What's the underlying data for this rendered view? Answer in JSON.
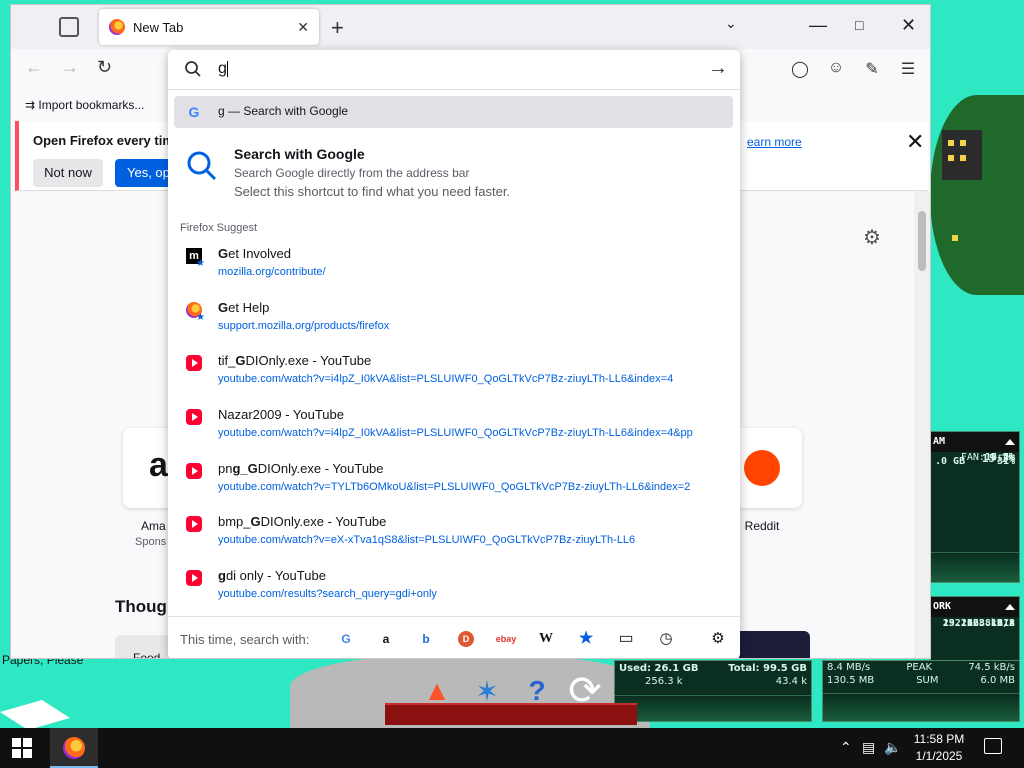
{
  "browser": {
    "tab_title": "New Tab",
    "bookmarks_item": "Import bookmarks...",
    "notice": {
      "text": "Open Firefox every time",
      "not_now": "Not now",
      "yes": "Yes, open",
      "learn": "earn more"
    },
    "thought_heading": "Though",
    "shortcuts": [
      {
        "label": "Ama",
        "sub": "Spons"
      },
      {
        "label": "Reddit"
      }
    ],
    "food_label": "Food"
  },
  "urlbar": {
    "value": "g",
    "first_result": "g — Search with Google",
    "tip": {
      "heading": "Search with Google",
      "line1": "Search Google directly from the address bar",
      "line2": "Select this shortcut to find what you need faster."
    },
    "group_label": "Firefox Suggest",
    "results": [
      {
        "bold": "G",
        "rest": "et Involved",
        "url": "mozilla.org/contribute/",
        "icon": "mozilla-icon"
      },
      {
        "bold": "G",
        "rest": "et Help",
        "url": "support.mozilla.org/products/firefox",
        "icon": "firefox-icon"
      },
      {
        "pre": "tif_",
        "bold": "G",
        "rest": "DIOnly.exe - YouTube",
        "url": "youtube.com/watch?v=i4lpZ_I0kVA&list=PLSLUIWF0_QoGLTkVcP7Bz-ziuyLTh-LL6&index=4",
        "icon": "youtube-icon"
      },
      {
        "pre": "",
        "bold": "",
        "rest": "Nazar2009 - YouTube",
        "url": "youtube.com/watch?v=i4lpZ_I0kVA&list=PLSLUIWF0_QoGLTkVcP7Bz-ziuyLTh-LL6&index=4&pp",
        "icon": "youtube-icon"
      },
      {
        "pre": "pn",
        "bold": "g_G",
        "rest": "DIOnly.exe - YouTube",
        "url": "youtube.com/watch?v=TYLTb6OMkoU&list=PLSLUIWF0_QoGLTkVcP7Bz-ziuyLTh-LL6&index=2",
        "icon": "youtube-icon"
      },
      {
        "pre": "bmp_",
        "bold": "G",
        "rest": "DIOnly.exe - YouTube",
        "url": "youtube.com/watch?v=eX-xTva1qS8&list=PLSLUIWF0_QoGLTkVcP7Bz-ziuyLTh-LL6",
        "icon": "youtube-icon"
      },
      {
        "pre": "",
        "bold": "g",
        "rest": "di only - YouTube",
        "url": "youtube.com/results?search_query=gdi+only",
        "icon": "youtube-icon"
      }
    ],
    "one_off_label": "This time, search with:",
    "engines": [
      "google-icon",
      "amazon-icon",
      "bing-icon",
      "duckduckgo-icon",
      "ebay-icon",
      "wikipedia-icon",
      "bookmarks-icon",
      "tabs-icon",
      "history-icon",
      "settings-icon"
    ]
  },
  "desktop": {
    "label": "Papers, Please",
    "ram": {
      "title": "AM",
      "rows": [
        "15.3%",
        "12.5%",
        "14.1%",
        "18.7%",
        "17.2%",
        "FAN: 0rpm"
      ],
      "bottom_left": ".0 GB",
      "bottom_right": "31%"
    },
    "net": {
      "title": "ORK",
      "ip1": "23.162.8.118",
      "ip2": "192.168.16.2",
      "speed": "23.3 kB/s"
    },
    "mem": {
      "used": "Used: 26.1 GB",
      "total": "Total: 99.5 GB",
      "v1": "256.3 k",
      "v2": "43.4 k"
    },
    "net2": {
      "r1_left": "8.4 MB/s",
      "r1_mid": "PEAK",
      "r1_right": "74.5 kB/s",
      "r2_left": "130.5 MB",
      "r2_mid": "SUM",
      "r2_right": "6.0 MB"
    }
  },
  "taskbar": {
    "time": "11:58 PM",
    "date": "1/1/2025"
  }
}
